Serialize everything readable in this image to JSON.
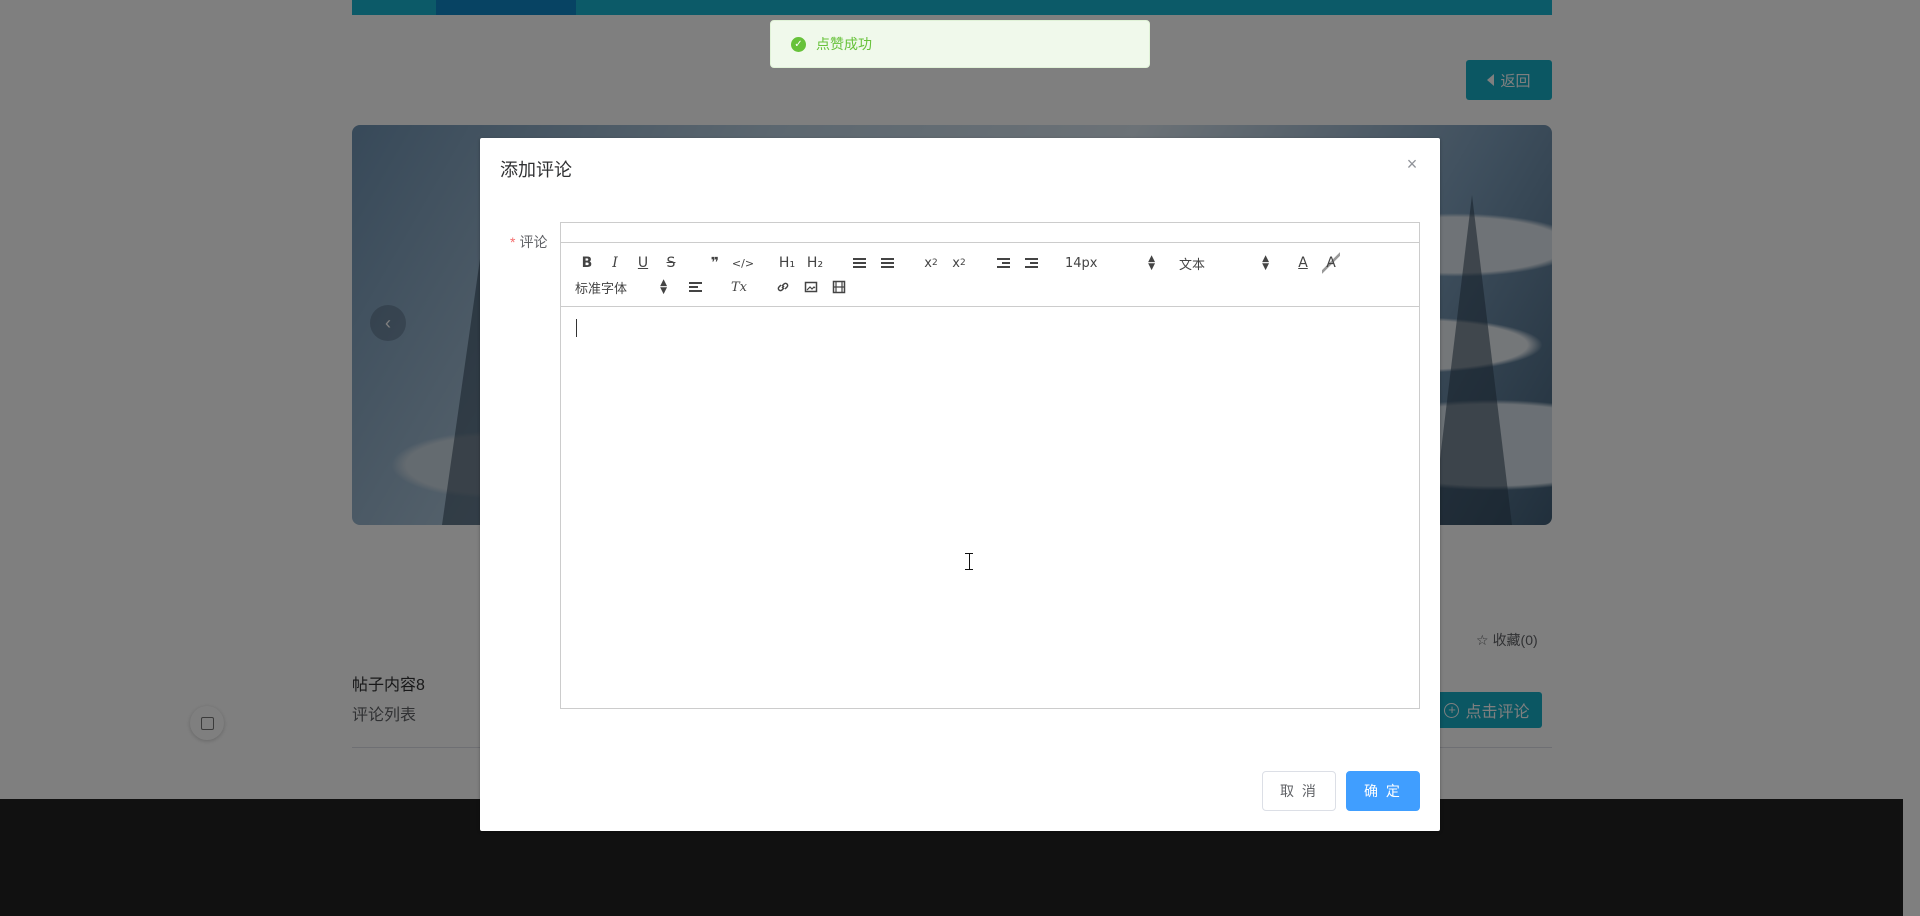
{
  "page": {
    "back_label": "返回",
    "post_title": "帖子内容8",
    "comment_list_label": "评论列表",
    "stat_partial": ")",
    "favorite_label": "收藏(0)",
    "comment_button_label": "点击评论",
    "prev_arrow": "‹"
  },
  "toast": {
    "message": "点赞成功"
  },
  "dialog": {
    "title": "添加评论",
    "close_glyph": "×",
    "field_label": "评论",
    "required_mark": "*",
    "cancel_label": "取 消",
    "confirm_label": "确 定"
  },
  "toolbar": {
    "bold": "B",
    "italic": "I",
    "underline": "U",
    "strike": "S",
    "blockquote": "❞",
    "code": "</>",
    "h1": "H₁",
    "h2": "H₂",
    "subscript": "x",
    "subscript_mark": "2",
    "superscript": "x",
    "superscript_mark": "2",
    "font_size": "14px",
    "header_select": "文本",
    "font_family": "标准字体",
    "clean": "Tx",
    "text_color": "A",
    "background_color": "A"
  },
  "colors": {
    "accent": "#16aec7",
    "primary": "#409eff",
    "success": "#67c23a",
    "footer": "#222222"
  }
}
